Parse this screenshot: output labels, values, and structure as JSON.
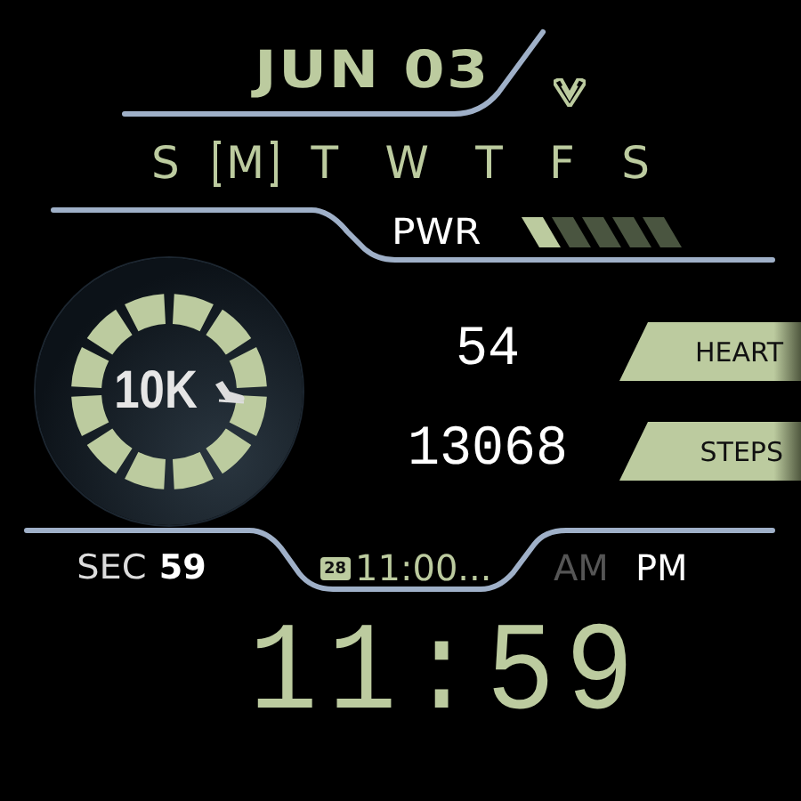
{
  "date": "JUN 03",
  "weekdays": [
    {
      "label": "S",
      "selected": false
    },
    {
      "label": "M",
      "selected": true
    },
    {
      "label": "T",
      "selected": false
    },
    {
      "label": "W",
      "selected": false
    },
    {
      "label": "T",
      "selected": false
    },
    {
      "label": "F",
      "selected": false
    },
    {
      "label": "S",
      "selected": false
    }
  ],
  "power": {
    "label": "PWR",
    "level": 0.2
  },
  "steps_goal": {
    "label": "10K"
  },
  "stats": [
    {
      "value": "54",
      "label": "HEART"
    },
    {
      "value": "13068",
      "label": "STEPS"
    }
  ],
  "seconds": {
    "label": "SEC",
    "value": "59"
  },
  "event": {
    "calendar_day": "28",
    "text": "11:00..."
  },
  "meridiem": [
    {
      "label": "AM",
      "selected": false
    },
    {
      "label": "PM",
      "selected": true
    }
  ],
  "time": "11:59"
}
